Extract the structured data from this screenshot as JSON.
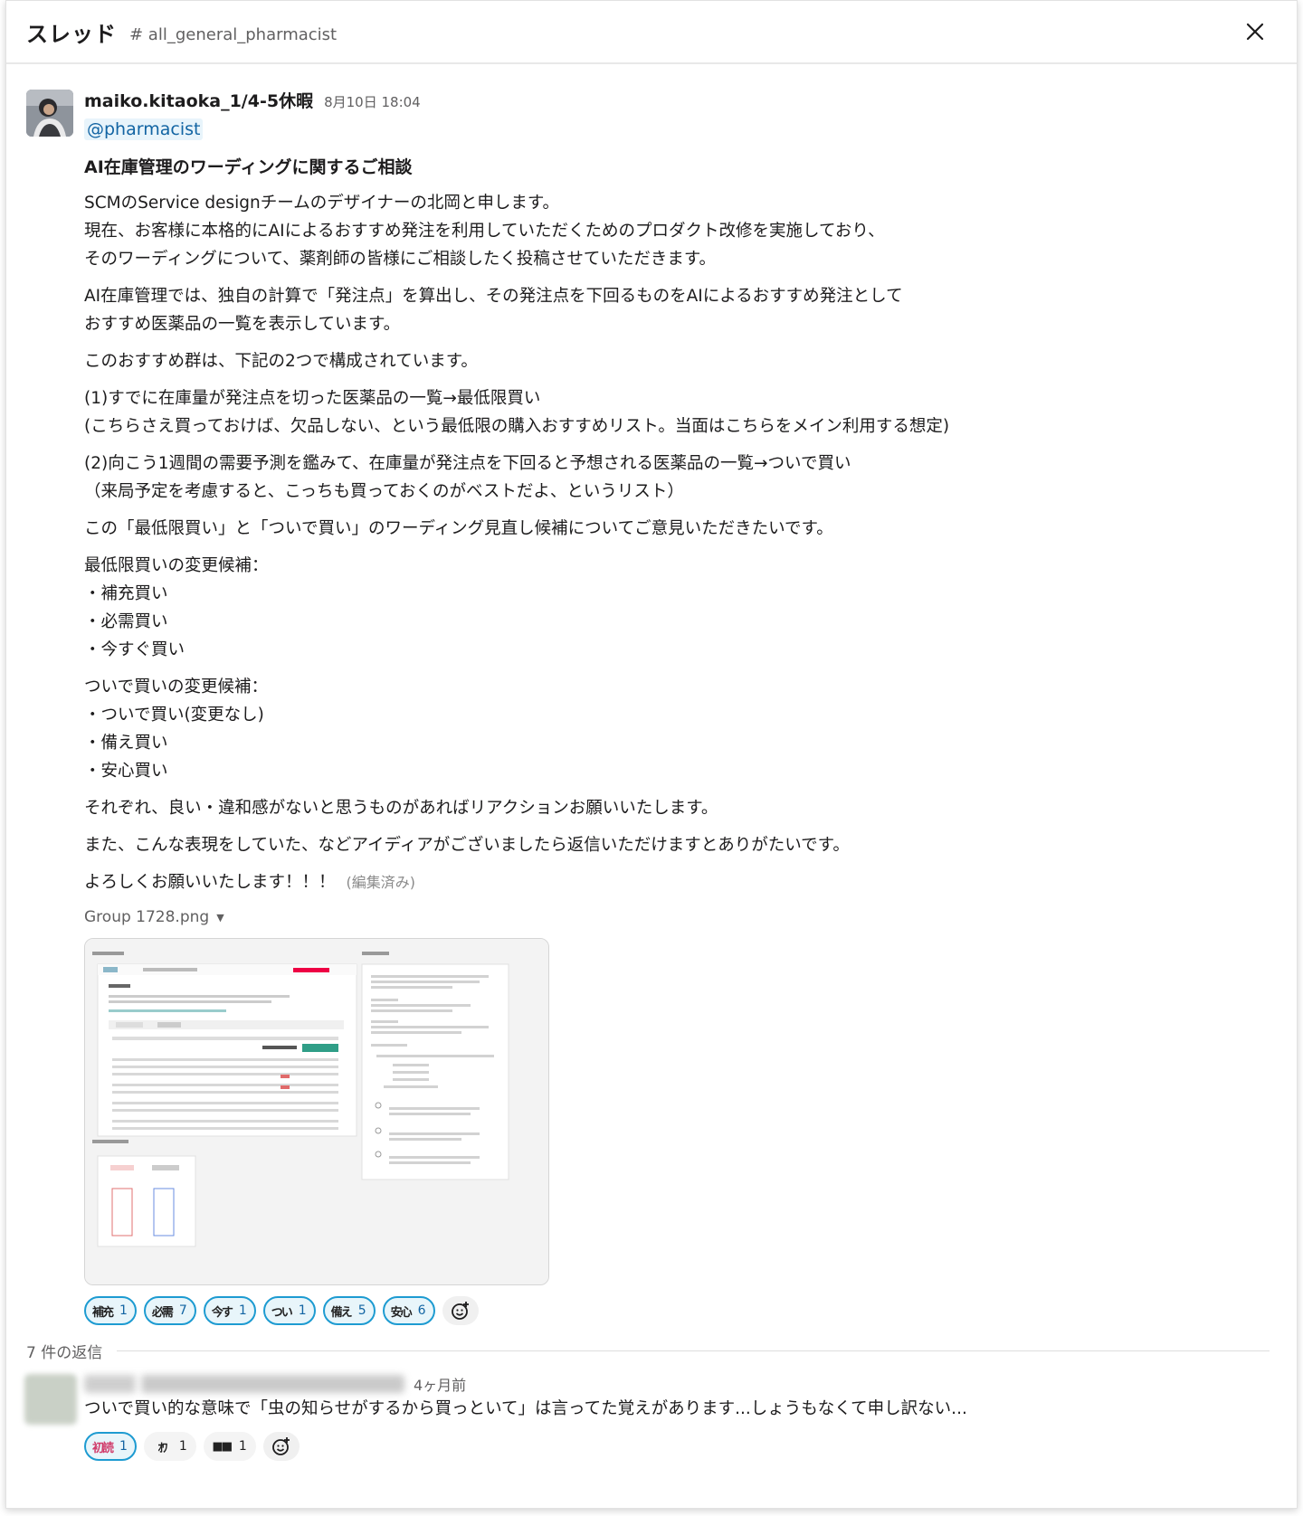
{
  "header": {
    "title": "スレッド",
    "channel": "# all_general_pharmacist"
  },
  "message": {
    "author": "maiko.kitaoka_1/4-5休暇",
    "timestamp": "8月10日 18:04",
    "mention": "@pharmacist",
    "title": "AI在庫管理のワーディングに関するご相談",
    "paragraphs": [
      "SCMのService designチームのデザイナーの北岡と申します。\n現在、お客様に本格的にAIによるおすすめ発注を利用していただくためのプロダクト改修を実施しており、\nそのワーディングについて、薬剤師の皆様にご相談したく投稿させていただきます。",
      "AI在庫管理では、独自の計算で「発注点」を算出し、その発注点を下回るものをAIによるおすすめ発注として\nおすすめ医薬品の一覧を表示しています。",
      "このおすすめ群は、下記の2つで構成されています。",
      "(1)すでに在庫量が発注点を切った医薬品の一覧→最低限買い\n(こちらさえ買っておけば、欠品しない、という最低限の購入おすすめリスト。当面はこちらをメイン利用する想定)",
      "(2)向こう1週間の需要予測を鑑みて、在庫量が発注点を下回ると予想される医薬品の一覧→ついで買い\n（来局予定を考慮すると、こっちも買っておくのがベストだよ、というリスト）",
      "この「最低限買い」と「ついで買い」のワーディング見直し候補についてご意見いただきたいです。",
      "最低限買いの変更候補：\n・補充買い\n・必需買い\n・今すぐ買い",
      "ついで買いの変更候補：\n・ついで買い(変更なし)\n・備え買い\n・安心買い\n",
      "それぞれ、良い・違和感がないと思うものがあればリアクションお願いいたします。",
      "また、こんな表現をしていた、などアイディアがございましたら返信いただけますとありがたいです。"
    ],
    "closing": "よろしくお願いいたします！！！",
    "edited": "(編集済み)",
    "file_name": "Group 1728.png",
    "reactions": [
      {
        "glyph": "補充",
        "count": "1"
      },
      {
        "glyph": "必需",
        "count": "7"
      },
      {
        "glyph": "今す",
        "count": "1"
      },
      {
        "glyph": "つい",
        "count": "1"
      },
      {
        "glyph": "備え",
        "count": "5"
      },
      {
        "glyph": "安心",
        "count": "6"
      }
    ]
  },
  "replies": {
    "count_label": "7 件の返信"
  },
  "reply": {
    "time": "4ヶ月前",
    "text": "ついで買い的な意味で「虫の知らせがするから買っといて」は言ってた覚えがあります...しょうもなくて申し訳ない...",
    "reactions": [
      {
        "glyph": "初読",
        "count": "1"
      },
      {
        "glyph": "ｵﾜ",
        "count": "1"
      },
      {
        "glyph": "■■",
        "count": "1"
      }
    ]
  },
  "icons": {
    "close": "close-icon",
    "add_reaction": "add-reaction-icon",
    "caret": "caret-down-icon"
  },
  "colors": {
    "mention_bg": "#e8f4fb",
    "mention_text": "#1264a3",
    "reaction_border": "#1d9bd1"
  }
}
